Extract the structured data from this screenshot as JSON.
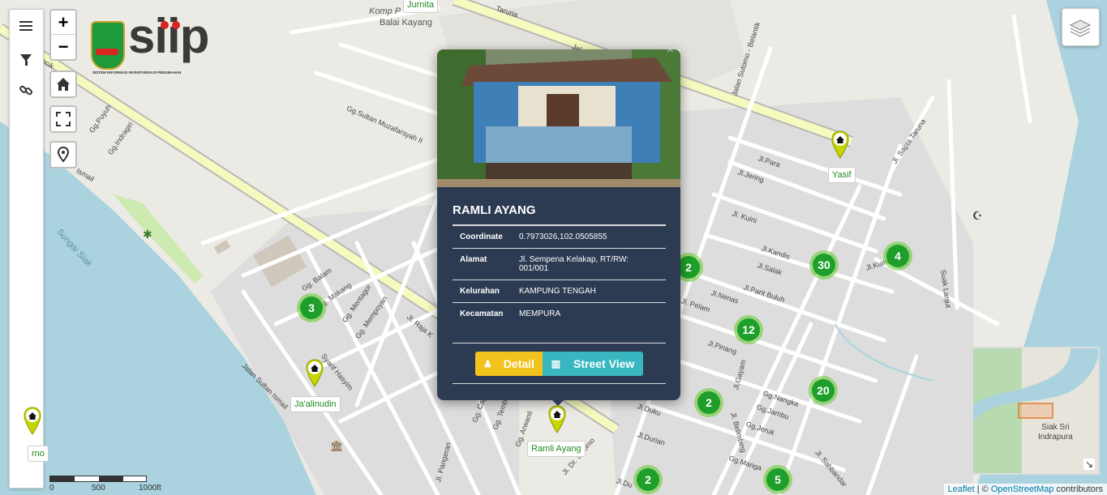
{
  "map": {
    "streets": [
      {
        "name": "Jl. Raja Kecik"
      },
      {
        "name": "Gg.Puyuh"
      },
      {
        "name": "Gg.Indragiri"
      },
      {
        "name": "Ismail"
      },
      {
        "name": "Gg.Sultan Muzafarsyah II"
      },
      {
        "name": "Jalan Sa"
      },
      {
        "name": "Jl. Raja K"
      },
      {
        "name": "Gg. Balam"
      },
      {
        "name": "Gg. Makang"
      },
      {
        "name": "Gg. Mentagor"
      },
      {
        "name": "Gg. Mempoyan"
      },
      {
        "name": "Syarif Hasyim"
      },
      {
        "name": "Jalan Sultan Ismail"
      },
      {
        "name": "Jalan Sutomo - Belantik"
      },
      {
        "name": "Jl.Para"
      },
      {
        "name": "Jl.Jering"
      },
      {
        "name": "Jl. Kuini"
      },
      {
        "name": "Jl.Kandis"
      },
      {
        "name": "Jl.Salak"
      },
      {
        "name": "Jl.Parit Buluh"
      },
      {
        "name": "Jl.Nenas"
      },
      {
        "name": "Jl. Pelam"
      },
      {
        "name": "Jl.Pinang"
      },
      {
        "name": "Jl.Kuini"
      },
      {
        "name": "Jl. Sapta Taruna"
      },
      {
        "name": "Suak Lanjut"
      },
      {
        "name": "Jl.Gayam"
      },
      {
        "name": "Gg.Nangka"
      },
      {
        "name": "Gg.Jambu"
      },
      {
        "name": "Jl. Belimbing"
      },
      {
        "name": "Gg.Jeruk"
      },
      {
        "name": "Gg.Manga"
      },
      {
        "name": "Jl. Sahbandar"
      },
      {
        "name": "Jl.Durian"
      },
      {
        "name": "Jl.Duku"
      },
      {
        "name": "Gg. Cagang Kemp"
      },
      {
        "name": "Gg. Tembusu"
      },
      {
        "name": "Jl. Pangeran"
      },
      {
        "name": "Jl. Dr. Sutomo"
      },
      {
        "name": "Taruna"
      },
      {
        "name": "Jl.Du"
      },
      {
        "name": "Gg. Arwanti"
      }
    ],
    "places": {
      "komp": "Komp P",
      "balai": "Balai Kayang",
      "river": "Sungai Siak",
      "jurnita": "Jurnita"
    }
  },
  "logo": {
    "title": "siip",
    "subtitle": "SISTEM INFORMASI INVENTARISASI PERUMAHAN"
  },
  "sidebar": {
    "icons": [
      "menu-icon",
      "filter-icon",
      "link-icon"
    ]
  },
  "controls": {
    "zoom_in": "+",
    "zoom_out": "−",
    "icons": [
      "home-icon",
      "fullscreen-icon",
      "location-icon",
      "layers-icon"
    ]
  },
  "clusters": [
    {
      "count": "3"
    },
    {
      "count": "2"
    },
    {
      "count": "30"
    },
    {
      "count": "4"
    },
    {
      "count": "12"
    },
    {
      "count": "2"
    },
    {
      "count": "20"
    },
    {
      "count": "2"
    },
    {
      "count": "5"
    }
  ],
  "markers": [
    {
      "label": "Yasif"
    },
    {
      "label": "Ja'alinudin"
    },
    {
      "label": "Ramli Ayang"
    },
    {
      "label": "rno"
    }
  ],
  "popup": {
    "close": "×",
    "title": "RAMLI AYANG",
    "rows": [
      {
        "key": "Coordinate",
        "value": "0.7973026,102.0505855"
      },
      {
        "key": "Alamat",
        "value": "Jl. Sempena Kelakap, RT/RW: 001/001"
      },
      {
        "key": "Kelurahan",
        "value": "KAMPUNG TENGAH"
      },
      {
        "key": "Kecamatan",
        "value": "MEMPURA"
      }
    ],
    "detail_label": "Detail",
    "street_label": "Street View"
  },
  "scale": {
    "labels": [
      "0",
      "500",
      "1000ft"
    ]
  },
  "minimap": {
    "label_line1": "Siak Sri",
    "label_line2": "Indrapura"
  },
  "attribution": {
    "leaflet": "Leaflet",
    "sep": " | © ",
    "osm": "OpenStreetMap",
    "suffix": " contributors"
  },
  "colors": {
    "cluster": "#1e9e2a",
    "cluster_halo": "#6ecc39",
    "popup_bg": "#2c3a52",
    "detail": "#f2c21d",
    "street": "#39b7c0",
    "river": "#aad3df",
    "marker": "#c6d600"
  }
}
